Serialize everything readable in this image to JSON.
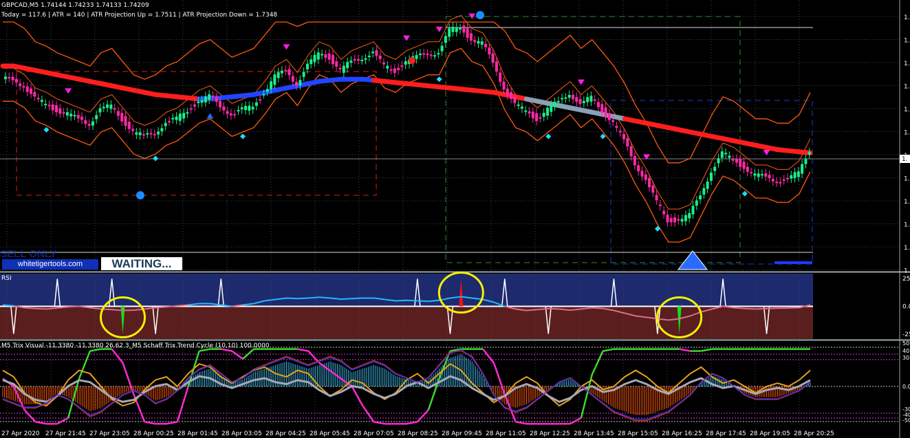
{
  "window": {
    "header_line": "GBPCAD,M5  1.74144 1.74233 1.74133 1.74209",
    "stats_line": "Today = 117.6   |   ATR = 140   |   ATR Projection Up = 1.7511   |   ATR Projection Down = 1.7348"
  },
  "overlay": {
    "partial_text": "SELL ONLY",
    "brand": "whitetigertools.com",
    "status": "WAITING..."
  },
  "subwindows": {
    "rsi_label": "RSI",
    "trix_label": "M5 Trix Visual -11.3380 -11.3380 26.62 3_M5 Schaff Trix Trend Cycle (10,10) 100.0000"
  },
  "colors": {
    "bull": "#17f08a",
    "bear": "#ff2aa4",
    "ma_red": "#ff1e1e",
    "ma_blue": "#2244ff",
    "ma_grey": "#8aa0b8",
    "band": "#ff5a0e",
    "rsi_upper": "#1e2a6e",
    "rsi_lower": "#5a1e1e",
    "rsi_line_high": "#27b8ff",
    "rsi_line_low": "#d8708c",
    "trix_hist_up": "#3fb6e6",
    "trix_hist_down": "#ff5a0e",
    "schaff_pink": "#ff2ad0",
    "schaff_green": "#3bd82e",
    "trix_orange": "#e8a21a",
    "trix_grey": "#a8a8b8",
    "trix_red": "#d8323a",
    "highlight": "#f5f000"
  },
  "chart_data": {
    "type": "line",
    "symbol": "GBPCAD",
    "timeframe": "M5",
    "ohlc": {
      "open": 1.74144,
      "high": 1.74233,
      "low": 1.74133,
      "close": 1.74209
    },
    "indicators": {
      "Today": 117.6,
      "ATR": 140,
      "ATR Projection Up": 1.7511,
      "ATR Projection Down": 1.7348
    },
    "x_tick_labels": [
      "27 Apr 2020",
      "27 Apr 21:45",
      "27 Apr 23:05",
      "28 Apr 00:25",
      "28 Apr 01:45",
      "28 Apr 03:05",
      "28 Apr 04:25",
      "28 Apr 05:45",
      "28 Apr 07:05",
      "28 Apr 08:25",
      "28 Apr 09:45",
      "28 Apr 11:05",
      "28 Apr 12:25",
      "28 Apr 13:45",
      "28 Apr 15:05",
      "28 Apr 16:25",
      "28 Apr 17:45",
      "28 Apr 19:05",
      "28 Apr 20:25"
    ],
    "price_axis_labels": [
      "1.",
      "1.",
      "1.",
      "1.",
      "1.",
      "1.",
      "1.",
      "1.",
      "1.",
      "1.",
      "1.",
      "1."
    ],
    "price_marker": "1.",
    "rsi_axis_labels": [
      "25",
      "0.0",
      "-25"
    ],
    "trix_axis_labels": [
      "50",
      "40",
      "30",
      "0.0",
      "-30",
      "-40",
      "-50"
    ],
    "price_series": [
      0.74,
      0.74,
      0.71,
      0.65,
      0.63,
      0.6,
      0.58,
      0.56,
      0.54,
      0.6,
      0.62,
      0.56,
      0.5,
      0.48,
      0.5,
      0.54,
      0.56,
      0.6,
      0.64,
      0.66,
      0.62,
      0.58,
      0.6,
      0.62,
      0.68,
      0.75,
      0.78,
      0.72,
      0.8,
      0.86,
      0.84,
      0.78,
      0.82,
      0.84,
      0.86,
      0.8,
      0.78,
      0.82,
      0.84,
      0.86,
      0.86,
      0.96,
      0.98,
      0.92,
      0.9,
      0.82,
      0.7,
      0.62,
      0.6,
      0.56,
      0.6,
      0.64,
      0.68,
      0.62,
      0.66,
      0.6,
      0.54,
      0.46,
      0.36,
      0.28,
      0.18,
      0.1,
      0.1,
      0.12,
      0.22,
      0.32,
      0.4,
      0.38,
      0.34,
      0.3,
      0.3,
      0.28,
      0.28,
      0.32,
      0.42
    ],
    "ma_series": [
      0.8,
      0.8,
      0.79,
      0.78,
      0.77,
      0.76,
      0.75,
      0.74,
      0.73,
      0.72,
      0.71,
      0.7,
      0.69,
      0.68,
      0.67,
      0.665,
      0.66,
      0.655,
      0.65,
      0.652,
      0.655,
      0.66,
      0.665,
      0.67,
      0.68,
      0.69,
      0.7,
      0.71,
      0.72,
      0.73,
      0.735,
      0.74,
      0.74,
      0.74,
      0.735,
      0.73,
      0.725,
      0.72,
      0.715,
      0.71,
      0.705,
      0.7,
      0.695,
      0.69,
      0.685,
      0.68,
      0.67,
      0.66,
      0.65,
      0.64,
      0.63,
      0.62,
      0.61,
      0.6,
      0.59,
      0.58,
      0.57,
      0.56,
      0.55,
      0.54,
      0.53,
      0.52,
      0.51,
      0.5,
      0.49,
      0.48,
      0.47,
      0.46,
      0.45,
      0.44,
      0.43,
      0.42,
      0.415,
      0.41,
      0.405
    ],
    "rsi_series": [
      0.05,
      0.02,
      -0.05,
      -0.08,
      -0.1,
      -0.06,
      -0.02,
      0.0,
      -0.05,
      -0.1,
      -0.12,
      -0.15,
      -0.14,
      -0.1,
      -0.05,
      -0.02,
      0.02,
      0.05,
      0.1,
      0.1,
      0.05,
      0.0,
      0.05,
      0.1,
      0.2,
      0.25,
      0.3,
      0.28,
      0.3,
      0.33,
      0.3,
      0.26,
      0.28,
      0.3,
      0.3,
      0.25,
      0.2,
      0.22,
      0.2,
      0.18,
      0.22,
      0.3,
      0.35,
      0.3,
      0.25,
      0.15,
      0.0,
      -0.1,
      -0.15,
      -0.12,
      -0.08,
      -0.1,
      -0.14,
      -0.1,
      -0.05,
      -0.08,
      -0.15,
      -0.25,
      -0.35,
      -0.4,
      -0.45,
      -0.5,
      -0.45,
      -0.35,
      -0.2,
      -0.1,
      0.0,
      -0.05,
      -0.08,
      -0.1,
      -0.08,
      -0.07,
      -0.06,
      -0.05,
      0.05
    ],
    "trix_hist": [
      -0.3,
      -0.4,
      -0.5,
      -0.5,
      -0.4,
      -0.2,
      -0.3,
      -0.5,
      -0.7,
      -0.6,
      -0.4,
      -0.2,
      -0.1,
      -0.2,
      -0.4,
      -0.3,
      -0.1,
      0.2,
      0.4,
      0.5,
      0.3,
      0.1,
      0.2,
      0.4,
      0.5,
      0.6,
      0.7,
      0.6,
      0.5,
      0.6,
      0.7,
      0.6,
      0.4,
      0.5,
      0.6,
      0.5,
      0.3,
      0.2,
      0.1,
      0.2,
      0.5,
      0.8,
      0.9,
      0.7,
      0.3,
      -0.2,
      -0.5,
      -0.6,
      -0.5,
      -0.3,
      -0.1,
      0.1,
      0.2,
      0.0,
      -0.2,
      -0.4,
      -0.6,
      -0.7,
      -0.8,
      -0.8,
      -0.7,
      -0.6,
      -0.4,
      -0.2,
      0.1,
      0.3,
      0.2,
      0.0,
      -0.2,
      -0.3,
      -0.3,
      -0.3,
      -0.2,
      -0.1,
      0.1
    ],
    "schaff_series": [
      0.2,
      0.0,
      -0.6,
      -0.9,
      -0.95,
      -0.95,
      -0.8,
      0.2,
      0.9,
      0.95,
      0.95,
      0.6,
      -0.2,
      -0.9,
      -0.95,
      -0.95,
      -0.9,
      0.0,
      0.9,
      0.95,
      0.95,
      0.9,
      0.7,
      0.95,
      0.95,
      0.95,
      0.95,
      0.95,
      0.9,
      0.6,
      0.4,
      0.2,
      0.0,
      -0.5,
      -0.9,
      -0.95,
      -0.95,
      -0.95,
      -0.9,
      -0.6,
      0.2,
      0.9,
      0.95,
      0.95,
      0.95,
      0.6,
      -0.2,
      -0.9,
      -0.95,
      -0.95,
      -0.95,
      -0.95,
      -0.95,
      -0.8,
      0.3,
      0.9,
      0.95,
      0.95,
      0.95,
      0.95,
      0.95,
      0.95,
      0.95,
      0.9,
      0.9,
      0.95,
      0.95,
      0.95,
      0.95,
      0.95,
      0.95,
      0.95,
      0.95,
      0.95,
      0.95
    ],
    "trix_line": [
      0.5,
      0.3,
      -0.2,
      -0.5,
      -0.6,
      -0.3,
      0.2,
      0.5,
      0.4,
      0.0,
      -0.4,
      -0.6,
      -0.5,
      -0.1,
      0.2,
      0.3,
      0.0,
      0.4,
      0.7,
      0.6,
      0.3,
      0.1,
      0.3,
      0.5,
      0.6,
      0.4,
      0.3,
      0.5,
      0.4,
      0.0,
      -0.3,
      -0.1,
      0.2,
      0.1,
      -0.2,
      -0.4,
      -0.2,
      0.2,
      0.4,
      0.1,
      0.4,
      0.7,
      0.5,
      0.1,
      -0.2,
      -0.5,
      -0.3,
      0.1,
      0.3,
      0.1,
      -0.3,
      -0.6,
      -0.4,
      0.0,
      0.2,
      -0.1,
      0.0,
      0.3,
      0.5,
      0.3,
      0.0,
      -0.2,
      0.1,
      0.4,
      0.6,
      0.3,
      0.1,
      0.2,
      0.0,
      -0.2,
      0.0,
      0.1,
      0.0,
      0.2,
      0.5
    ],
    "rsi_alerts": [
      {
        "index": 11,
        "direction": "down"
      },
      {
        "index": 42,
        "direction": "up"
      },
      {
        "index": 62,
        "direction": "down"
      }
    ]
  }
}
